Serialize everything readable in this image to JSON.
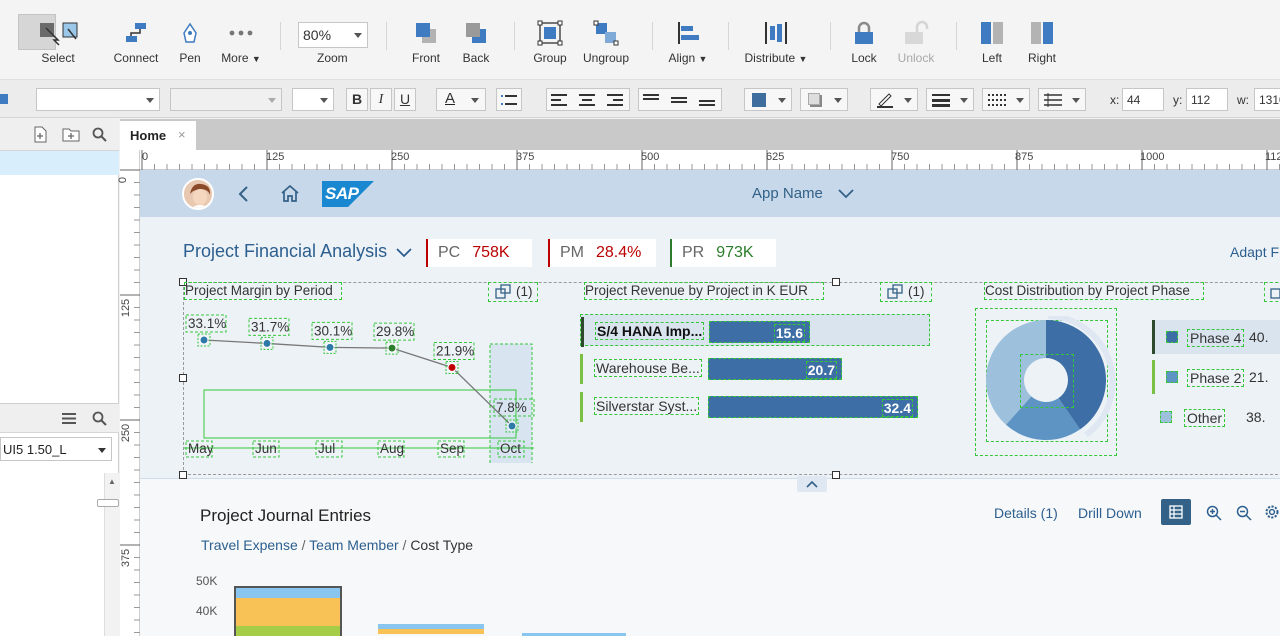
{
  "toolbar": {
    "select_label": "Select",
    "connect_label": "Connect",
    "pen_label": "Pen",
    "more_label": "More",
    "zoom_value": "80%",
    "zoom_label": "Zoom",
    "front_label": "Front",
    "back_label": "Back",
    "group_label": "Group",
    "ungroup_label": "Ungroup",
    "align_label": "Align",
    "distribute_label": "Distribute",
    "lock_label": "Lock",
    "unlock_label": "Unlock",
    "left_label": "Left",
    "right_label": "Right"
  },
  "format": {
    "bold": "B",
    "italic": "I",
    "underline": "U",
    "font_color": "A",
    "x_label": "x:",
    "x_value": "44",
    "y_label": "y:",
    "y_value": "112",
    "w_label": "w:",
    "w_value": "1310"
  },
  "left_panel": {
    "library_value": "UI5 1.50_L"
  },
  "tabs": [
    {
      "label": "Home",
      "close": "×"
    }
  ],
  "rulers": {
    "horizontal": [
      "0",
      "125",
      "250",
      "375",
      "500",
      "625",
      "750",
      "875",
      "1000",
      "112"
    ],
    "vertical": [
      "0",
      "125",
      "250",
      "375"
    ]
  },
  "app": {
    "shell_title": "App Name",
    "brand": "SAP",
    "page_title": "Project Financial Analysis",
    "adapt_label": "Adapt F",
    "kpis": [
      {
        "key": "PC",
        "value": "758K",
        "color": "#bb0000"
      },
      {
        "key": "PM",
        "value": "28.4%",
        "color": "#bb0000"
      },
      {
        "key": "PR",
        "value": "973K",
        "color": "#2b7d2b"
      }
    ],
    "cards": {
      "margin": {
        "title": "Project Margin by Period",
        "count": "(1)"
      },
      "revenue": {
        "title": "Project Revenue by Project in K EUR",
        "count": "(1)"
      },
      "cost": {
        "title": "Cost Distribution by Project Phase"
      }
    },
    "journal": {
      "title": "Project Journal Entries",
      "crumb1": "Travel Expense",
      "crumb2": "Team Member",
      "crumb_sep": "/",
      "crumb3": "Cost Type",
      "details_label": "Details (1)",
      "drill_label": "Drill Down",
      "y_ticks": [
        "50K",
        "40K"
      ]
    }
  },
  "chart_data": [
    {
      "type": "line",
      "title": "Project Margin by Period",
      "categories": [
        "May",
        "Jun",
        "Jul",
        "Aug",
        "Sep",
        "Oct"
      ],
      "value_labels": [
        "33.1%",
        "31.7%",
        "30.1%",
        "29.8%",
        "21.9%",
        "7.8%"
      ],
      "values": [
        33.1,
        31.7,
        30.1,
        29.8,
        21.9,
        7.8
      ],
      "ylim": [
        0,
        40
      ]
    },
    {
      "type": "bar",
      "title": "Project Revenue by Project in K EUR",
      "categories": [
        "S/4 HANA Imp...",
        "Warehouse Be...",
        "Silverstar Syst..."
      ],
      "value_labels": [
        "15.6",
        "20.7",
        "32.4"
      ],
      "values": [
        15.6,
        20.7,
        32.4
      ],
      "xlim": [
        0,
        32.4
      ]
    },
    {
      "type": "pie",
      "title": "Cost Distribution by Project Phase",
      "legend": [
        {
          "label": "Phase 4",
          "value_label": "40.",
          "color": "#3d6fa6"
        },
        {
          "label": "Phase 2",
          "value_label": "21.",
          "color": "#5e94c4"
        },
        {
          "label": "Other",
          "value_label": "38.",
          "color": "#9dc0dc"
        }
      ],
      "values": [
        40,
        21,
        38
      ]
    }
  ]
}
